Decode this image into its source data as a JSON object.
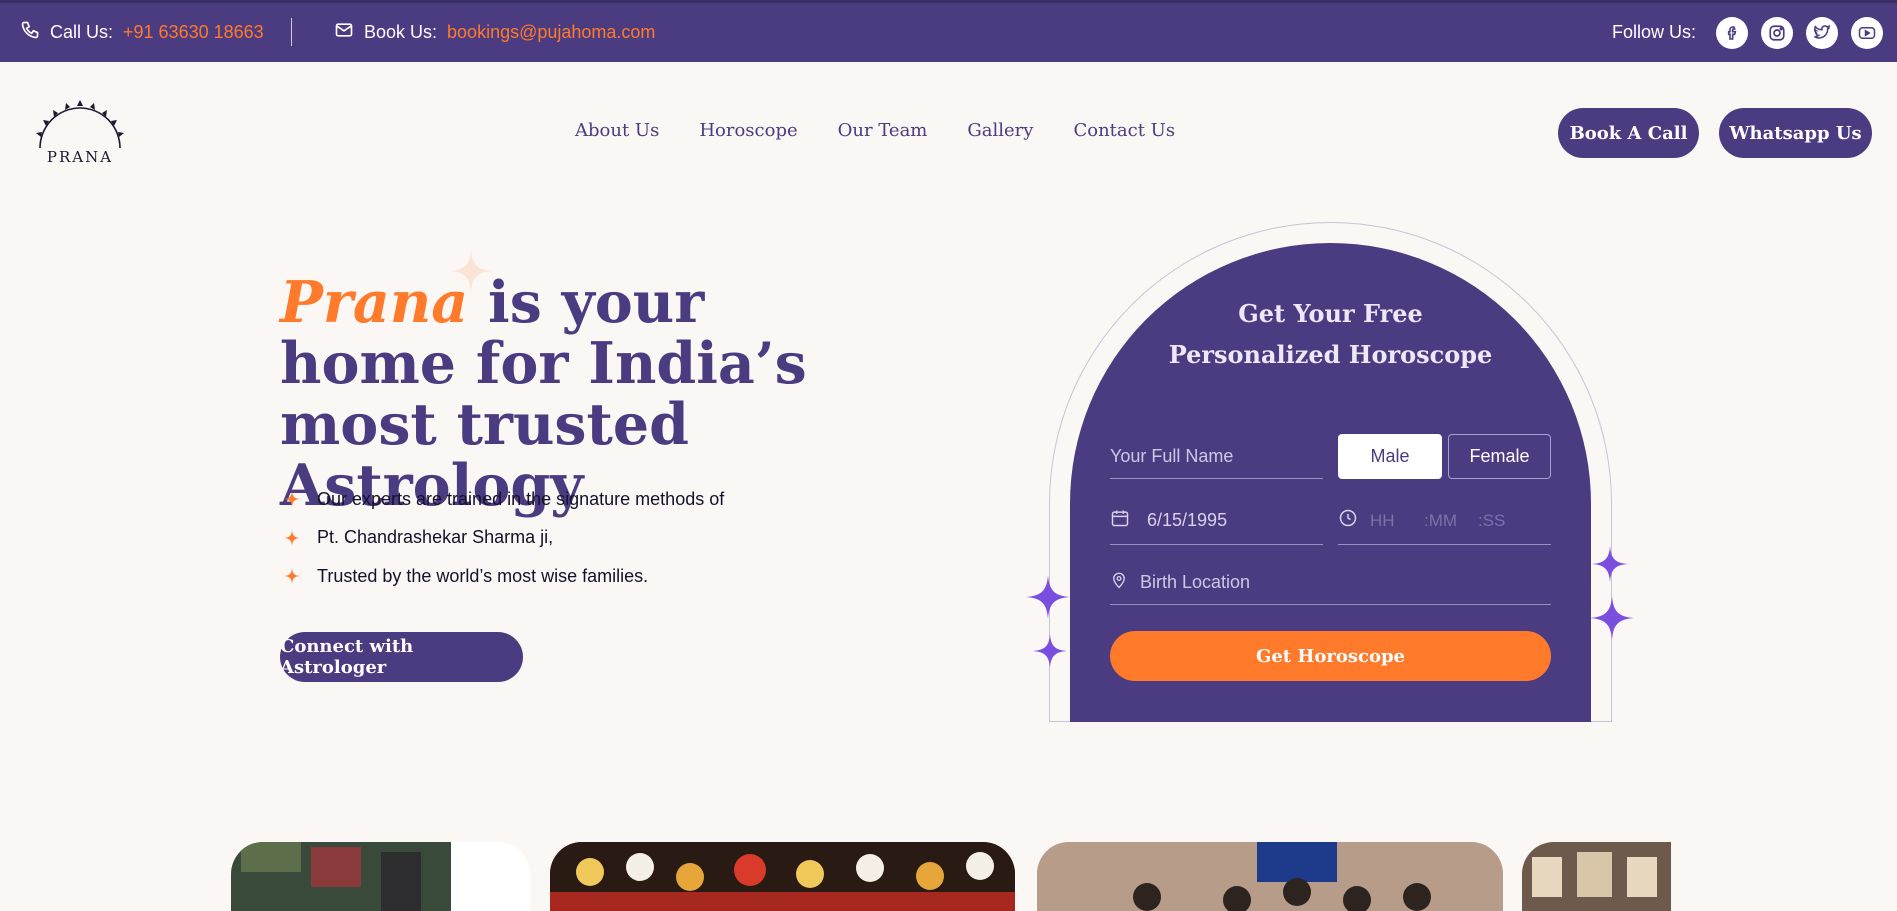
{
  "topbar": {
    "call_label": "Call Us:",
    "call_number": "+91 63630 18663",
    "book_label": "Book Us:",
    "book_email": "bookings@pujahoma.com",
    "follow_label": "Follow Us:",
    "socials": [
      "facebook-icon",
      "instagram-icon",
      "twitter-icon",
      "youtube-icon"
    ]
  },
  "brand": {
    "name": "PRANA"
  },
  "nav": {
    "items": [
      "About Us",
      "Horoscope",
      "Our Team",
      "Gallery",
      "Contact Us"
    ],
    "book_call": "Book A Call",
    "whatsapp": "Whatsapp Us"
  },
  "hero": {
    "title_accent": "Prana",
    "title_rest": " is your home for India’s most trusted Astrology",
    "bullets": [
      "Our experts are trained in the signature methods of",
      "Pt. Chandrashekar Sharma ji,",
      "Trusted by the world’s most wise families."
    ],
    "cta": "Connect with Astrologer"
  },
  "horoscope_form": {
    "title_line1": "Get Your Free",
    "title_line2": "Personalized Horoscope",
    "name_placeholder": "Your Full Name",
    "gender_options": [
      "Male",
      "Female"
    ],
    "gender_selected": "Male",
    "dob_value": "6/15/1995",
    "time_hh": "HH",
    "time_mm": ":MM",
    "time_ss": ":SS",
    "location_placeholder": "Birth Location",
    "submit": "Get Horoscope"
  },
  "colors": {
    "primary": "#4b3b80",
    "accent": "#ff7a2a",
    "background": "#faf7f4"
  }
}
